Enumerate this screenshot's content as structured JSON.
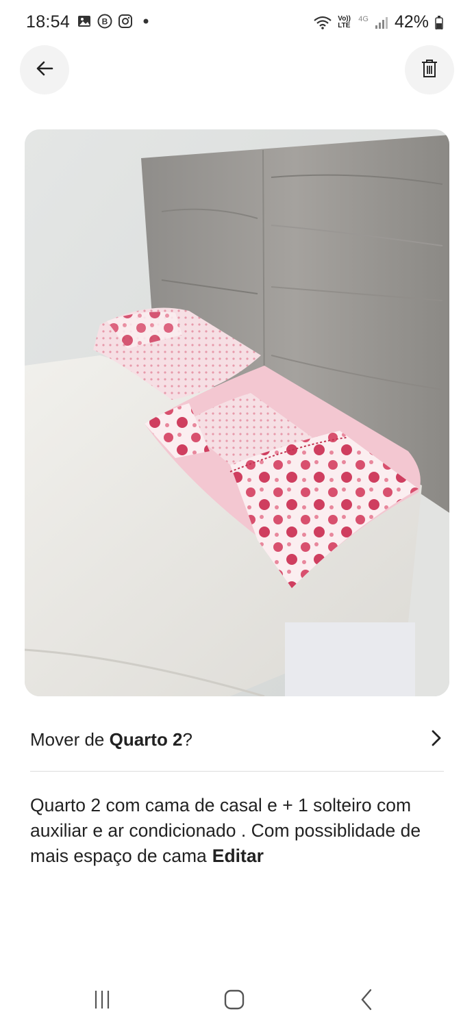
{
  "status_bar": {
    "time": "18:54",
    "network_label": "Vo)) LTE",
    "network_type": "4G",
    "battery": "42%",
    "left_icons": [
      "gallery-icon",
      "b-app-icon",
      "instagram-icon",
      "dot-icon"
    ],
    "right_icons": [
      "wifi-icon",
      "signal-icon",
      "battery-icon"
    ]
  },
  "toolbar": {
    "back_icon": "arrow-left-icon",
    "delete_icon": "trash-icon"
  },
  "photo": {
    "subject": "bed-with-pink-pillows"
  },
  "move": {
    "prefix": "Mover de ",
    "room": "Quarto 2",
    "suffix": "?",
    "chevron_icon": "chevron-right-icon"
  },
  "description": {
    "text": "Quarto 2 com cama de casal e + 1 solteiro com auxiliar e ar condicionado . Com possiblidade de mais espaço de cama",
    "edit_label": "Editar"
  },
  "nav_bar": {
    "recents_icon": "recents-icon",
    "home_icon": "home-icon",
    "back_icon": "back-chevron-icon"
  },
  "colors": {
    "background": "#ffffff",
    "text": "#222222",
    "button_bg": "#f3f3f3",
    "divider": "#dcdcdc"
  }
}
